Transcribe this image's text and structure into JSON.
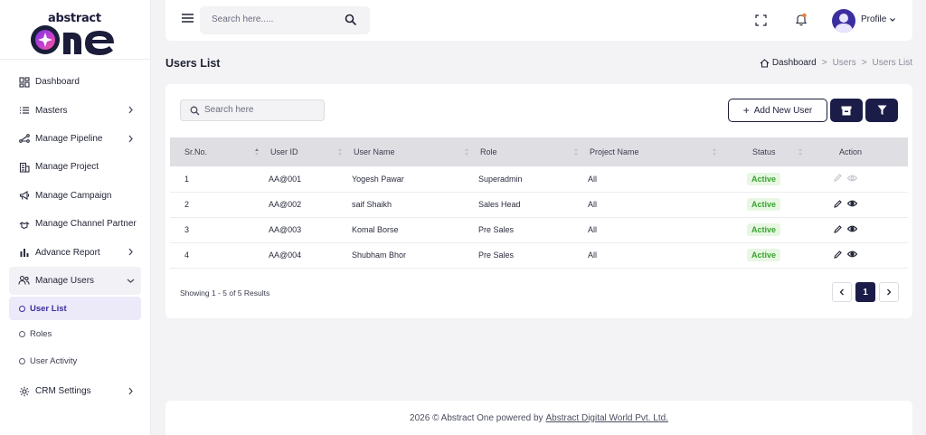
{
  "brand": {
    "top": "abstract",
    "main": "one"
  },
  "sidebar": {
    "items": [
      {
        "label": "Dashboard",
        "icon": "grid-icon"
      },
      {
        "label": "Masters",
        "icon": "list-icon"
      },
      {
        "label": "Manage Pipeline",
        "icon": "pipeline-icon"
      },
      {
        "label": "Manage Project",
        "icon": "building-icon"
      },
      {
        "label": "Manage Campaign",
        "icon": "megaphone-icon"
      },
      {
        "label": "Manage Channel Partner",
        "icon": "handshake-icon"
      },
      {
        "label": "Advance Report",
        "icon": "bar-chart-icon"
      },
      {
        "label": "Manage Users",
        "icon": "users-icon"
      }
    ],
    "users_sub": [
      {
        "label": "User List",
        "active": true
      },
      {
        "label": "Roles"
      },
      {
        "label": "User Activity"
      }
    ],
    "crm_settings": "CRM Settings"
  },
  "topbar": {
    "search_placeholder": "Search here.....",
    "profile_label": "Profile"
  },
  "page": {
    "title": "Users List",
    "breadcrumb": [
      "Dashboard",
      "Users",
      "Users List"
    ]
  },
  "toolbar": {
    "search_placeholder": "Search here",
    "add_label": "Add New User"
  },
  "table": {
    "headers": [
      "Sr.No.",
      "User ID",
      "User Name",
      "Role",
      "Project Name",
      "Status",
      "Action"
    ],
    "rows": [
      [
        "1",
        "AA@001",
        "Yogesh Pawar",
        "Superadmin",
        "All",
        "Active"
      ],
      [
        "2",
        "AA@002",
        "saif Shaikh",
        "Sales Head",
        "All",
        "Active"
      ],
      [
        "3",
        "AA@003",
        "Komal Borse",
        "Pre Sales",
        "All",
        "Active"
      ],
      [
        "4",
        "AA@004",
        "Shubham Bhor",
        "Pre Sales",
        "All",
        "Active"
      ]
    ]
  },
  "pagination": {
    "summary": "Showing 1 - 5 of 5 Results",
    "current": "1"
  },
  "footer": {
    "text": "2026 © Abstract One powered by",
    "link": "Abstract Digital World Pvt. Ltd."
  },
  "colors": {
    "primary": "#1b1d48",
    "accent": "#3b2e9e",
    "active_badge_bg": "#e7f7e2",
    "active_badge_text": "#3aa32f"
  }
}
